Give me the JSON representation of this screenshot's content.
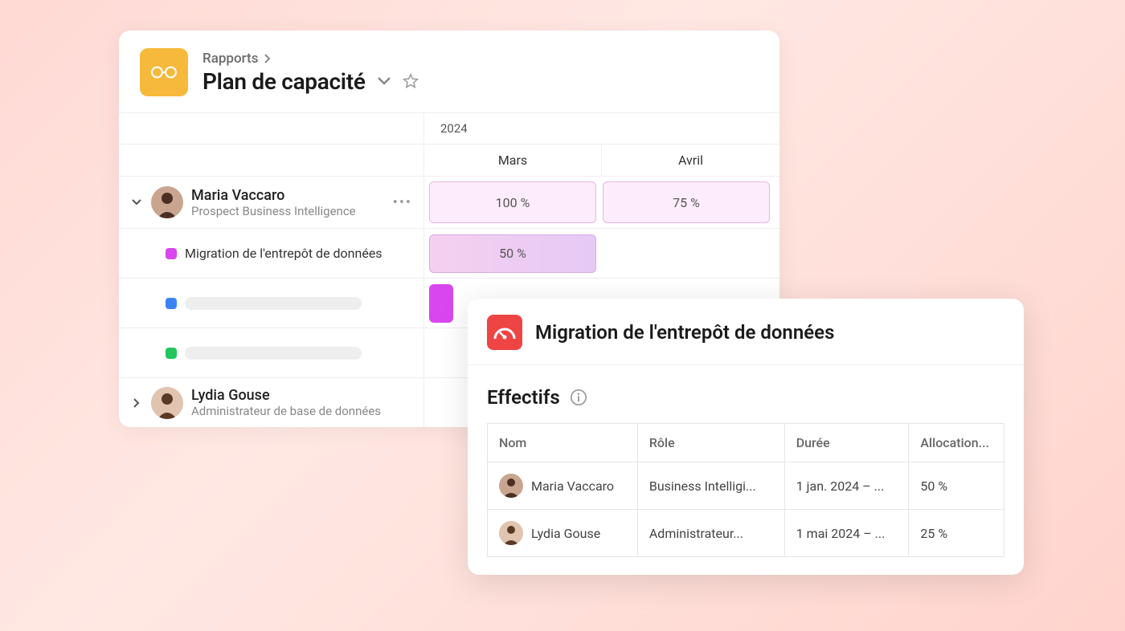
{
  "header": {
    "breadcrumb": "Rapports",
    "title": "Plan de capacité"
  },
  "timeline": {
    "year": "2024",
    "months": [
      "Mars",
      "Avril"
    ]
  },
  "people": [
    {
      "name": "Maria Vaccaro",
      "role": "Prospect Business Intelligence",
      "allocations": [
        "100 %",
        "75 %"
      ],
      "tasks": [
        {
          "color": "magenta",
          "label": "Migration de l'entrepôt de données",
          "bar_value": "50 %"
        },
        {
          "color": "blue",
          "label": ""
        },
        {
          "color": "green",
          "label": ""
        }
      ]
    },
    {
      "name": "Lydia Gouse",
      "role": "Administrateur de base de données"
    }
  ],
  "detail": {
    "title": "Migration de l'entrepôt de données",
    "section": "Effectifs",
    "columns": {
      "nom": "Nom",
      "role": "Rôle",
      "duree": "Durée",
      "alloc": "Allocation..."
    },
    "rows": [
      {
        "nom": "Maria Vaccaro",
        "role": "Business Intelligi...",
        "duree": "1 jan. 2024 – ...",
        "alloc": "50 %"
      },
      {
        "nom": "Lydia Gouse",
        "role": "Administrateur...",
        "duree": "1 mai 2024 – ...",
        "alloc": "25 %"
      }
    ]
  }
}
